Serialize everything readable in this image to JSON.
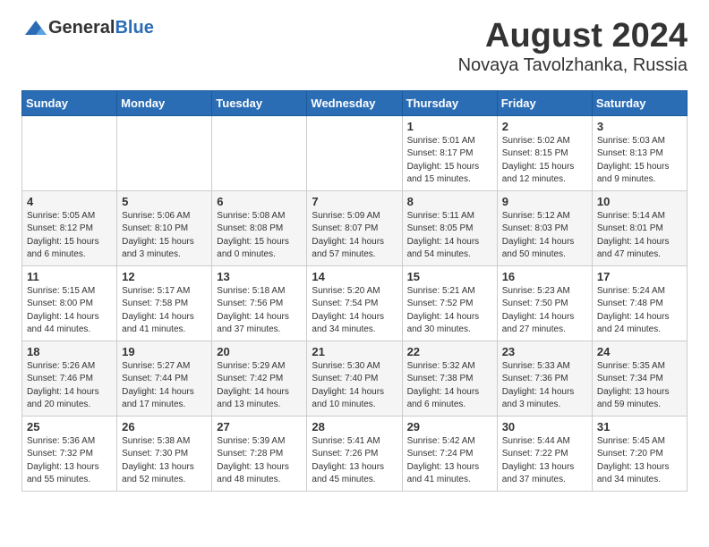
{
  "logo": {
    "general": "General",
    "blue": "Blue"
  },
  "title": "August 2024",
  "subtitle": "Novaya Tavolzhanka, Russia",
  "days_of_week": [
    "Sunday",
    "Monday",
    "Tuesday",
    "Wednesday",
    "Thursday",
    "Friday",
    "Saturday"
  ],
  "weeks": [
    [
      {
        "day": "",
        "info": ""
      },
      {
        "day": "",
        "info": ""
      },
      {
        "day": "",
        "info": ""
      },
      {
        "day": "",
        "info": ""
      },
      {
        "day": "1",
        "info": "Sunrise: 5:01 AM\nSunset: 8:17 PM\nDaylight: 15 hours\nand 15 minutes."
      },
      {
        "day": "2",
        "info": "Sunrise: 5:02 AM\nSunset: 8:15 PM\nDaylight: 15 hours\nand 12 minutes."
      },
      {
        "day": "3",
        "info": "Sunrise: 5:03 AM\nSunset: 8:13 PM\nDaylight: 15 hours\nand 9 minutes."
      }
    ],
    [
      {
        "day": "4",
        "info": "Sunrise: 5:05 AM\nSunset: 8:12 PM\nDaylight: 15 hours\nand 6 minutes."
      },
      {
        "day": "5",
        "info": "Sunrise: 5:06 AM\nSunset: 8:10 PM\nDaylight: 15 hours\nand 3 minutes."
      },
      {
        "day": "6",
        "info": "Sunrise: 5:08 AM\nSunset: 8:08 PM\nDaylight: 15 hours\nand 0 minutes."
      },
      {
        "day": "7",
        "info": "Sunrise: 5:09 AM\nSunset: 8:07 PM\nDaylight: 14 hours\nand 57 minutes."
      },
      {
        "day": "8",
        "info": "Sunrise: 5:11 AM\nSunset: 8:05 PM\nDaylight: 14 hours\nand 54 minutes."
      },
      {
        "day": "9",
        "info": "Sunrise: 5:12 AM\nSunset: 8:03 PM\nDaylight: 14 hours\nand 50 minutes."
      },
      {
        "day": "10",
        "info": "Sunrise: 5:14 AM\nSunset: 8:01 PM\nDaylight: 14 hours\nand 47 minutes."
      }
    ],
    [
      {
        "day": "11",
        "info": "Sunrise: 5:15 AM\nSunset: 8:00 PM\nDaylight: 14 hours\nand 44 minutes."
      },
      {
        "day": "12",
        "info": "Sunrise: 5:17 AM\nSunset: 7:58 PM\nDaylight: 14 hours\nand 41 minutes."
      },
      {
        "day": "13",
        "info": "Sunrise: 5:18 AM\nSunset: 7:56 PM\nDaylight: 14 hours\nand 37 minutes."
      },
      {
        "day": "14",
        "info": "Sunrise: 5:20 AM\nSunset: 7:54 PM\nDaylight: 14 hours\nand 34 minutes."
      },
      {
        "day": "15",
        "info": "Sunrise: 5:21 AM\nSunset: 7:52 PM\nDaylight: 14 hours\nand 30 minutes."
      },
      {
        "day": "16",
        "info": "Sunrise: 5:23 AM\nSunset: 7:50 PM\nDaylight: 14 hours\nand 27 minutes."
      },
      {
        "day": "17",
        "info": "Sunrise: 5:24 AM\nSunset: 7:48 PM\nDaylight: 14 hours\nand 24 minutes."
      }
    ],
    [
      {
        "day": "18",
        "info": "Sunrise: 5:26 AM\nSunset: 7:46 PM\nDaylight: 14 hours\nand 20 minutes."
      },
      {
        "day": "19",
        "info": "Sunrise: 5:27 AM\nSunset: 7:44 PM\nDaylight: 14 hours\nand 17 minutes."
      },
      {
        "day": "20",
        "info": "Sunrise: 5:29 AM\nSunset: 7:42 PM\nDaylight: 14 hours\nand 13 minutes."
      },
      {
        "day": "21",
        "info": "Sunrise: 5:30 AM\nSunset: 7:40 PM\nDaylight: 14 hours\nand 10 minutes."
      },
      {
        "day": "22",
        "info": "Sunrise: 5:32 AM\nSunset: 7:38 PM\nDaylight: 14 hours\nand 6 minutes."
      },
      {
        "day": "23",
        "info": "Sunrise: 5:33 AM\nSunset: 7:36 PM\nDaylight: 14 hours\nand 3 minutes."
      },
      {
        "day": "24",
        "info": "Sunrise: 5:35 AM\nSunset: 7:34 PM\nDaylight: 13 hours\nand 59 minutes."
      }
    ],
    [
      {
        "day": "25",
        "info": "Sunrise: 5:36 AM\nSunset: 7:32 PM\nDaylight: 13 hours\nand 55 minutes."
      },
      {
        "day": "26",
        "info": "Sunrise: 5:38 AM\nSunset: 7:30 PM\nDaylight: 13 hours\nand 52 minutes."
      },
      {
        "day": "27",
        "info": "Sunrise: 5:39 AM\nSunset: 7:28 PM\nDaylight: 13 hours\nand 48 minutes."
      },
      {
        "day": "28",
        "info": "Sunrise: 5:41 AM\nSunset: 7:26 PM\nDaylight: 13 hours\nand 45 minutes."
      },
      {
        "day": "29",
        "info": "Sunrise: 5:42 AM\nSunset: 7:24 PM\nDaylight: 13 hours\nand 41 minutes."
      },
      {
        "day": "30",
        "info": "Sunrise: 5:44 AM\nSunset: 7:22 PM\nDaylight: 13 hours\nand 37 minutes."
      },
      {
        "day": "31",
        "info": "Sunrise: 5:45 AM\nSunset: 7:20 PM\nDaylight: 13 hours\nand 34 minutes."
      }
    ]
  ]
}
